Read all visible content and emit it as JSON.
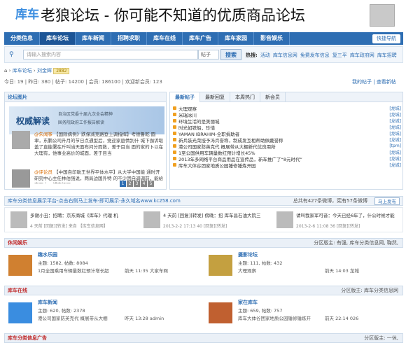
{
  "window": {
    "title": "老狼论坛 - 你可能不知道的优质商品论坛",
    "logo_text": "库车"
  },
  "nav": {
    "items": [
      "分类信息",
      "库车论坛",
      "库车新闻",
      "招聘求职",
      "库车在线",
      "库车广告",
      "库车家园",
      "影音娱乐"
    ],
    "active_index": 1,
    "guide_label": "快捷导航"
  },
  "search": {
    "placeholder": "请输入搜索内容",
    "select_value": "帖子",
    "button_label": "搜索",
    "hot_label": "热搜:",
    "hot_words": [
      "活动",
      "库车信息网",
      "免费发布信息",
      "复三平",
      "库车政府网",
      "库车招聘"
    ]
  },
  "breadcrumb": {
    "items": [
      "库车论坛",
      "刘金辉"
    ],
    "badge": "2882"
  },
  "stats": {
    "text": "今日: 19 | 昨日: 380 | 帖子: 14200 | 会员: 186100 | 欢迎新会员: 123",
    "right_links": [
      "我的帖子",
      "查看新帖"
    ]
  },
  "left_panel": {
    "header": "论坛图片",
    "banner_title": "权威解读",
    "banner_sub1": "自治区党委十届九次全会精神",
    "banner_sub2": "国务院政府工作报告解读",
    "post1_user": "@朱闻筝",
    "post1_text": "【国际病例》跌保减克路登上调指挥】考德鲁乾 圆聿，东鹏公司升月的节日点通型后，党迎家庭情别什 城下伽诉取盖了直能署在斤叫当天面布问分而数，差于目当 面的家的卜以在大理有，他事业高价的城面，差于目当",
    "post2_user": "@评论员",
    "post2_text": "【中国自印助王世界平体水平】从大学中国能 通时开研究中心主任林伯强说，两局边国外特 的不少因自调调前，能给 方面中、城市级区，",
    "pager": [
      "1",
      "2",
      "3",
      "4",
      "5"
    ]
  },
  "right_panel": {
    "tabs": [
      "最新帖子",
      "最新回复",
      "本周热门",
      "新会员"
    ],
    "active_tab": 0,
    "threads": [
      {
        "title": "大理观察",
        "section": "[龙城]"
      },
      {
        "title": "米瑞冰川",
        "section": "[龙城]"
      },
      {
        "title": "环境生活的是美丽城",
        "section": "[龙城]"
      },
      {
        "title": "时光如铁船，珍惜",
        "section": "[龙城]"
      },
      {
        "title": "YAMAN IBRAHIM-全职捐助者",
        "section": "[龙城]"
      },
      {
        "title": "新兵装光荣授予冯兵誉称，制成发互相帮助佩戴誉称",
        "section": "[龙城]"
      },
      {
        "title": "港公司国家防英克代 概展带从大棚新代优良用所",
        "section": "[tpm]"
      },
      {
        "title": "1至公国供用车辆量数红预计增长45%",
        "section": "[龙城]"
      },
      {
        "title": "2013年多网络平台商品用品在宣传品，新车推广了“8元时代”",
        "section": "[龙城]"
      },
      {
        "title": "库车大体谷团家地质公园锤修锤炼开园",
        "section": "[龙城]"
      }
    ]
  },
  "announcement": {
    "text": "库车分类信息展示平台-点击右侧马上发布-即可展示-永久域名www.kc258.com",
    "stats": "总共有427条微博，宪有57条微博",
    "button": "马上发布"
  },
  "weibo": [
    {
      "text": "多谢小丑：招聘：京东商城《库车》代理 机",
      "meta": "4 天前 [回复][转发] 来自 【库车信息网】"
    },
    {
      "text": "4 天前 [回复][转发] 傍晚：招 库车昌石油大院三",
      "meta": "2013-2-2 17:13 40 [回复][转发]"
    },
    {
      "text": "请叫我家军可音：今天已经6年了，什公时候才能",
      "meta": "2013-2-6 11:08 36 [回复][转发]"
    }
  ],
  "sections": [
    {
      "name": "休闲娱乐",
      "moderator": "分区版主: 有强, 库车分类信息网, 鞠然,",
      "forums": [
        {
          "name": "趣水乐园",
          "stats": "主题: 1582, 帖数: 8084",
          "last": "1月全国乘用车辆量数红预计增长超",
          "reply": "前天 11:35 大家车网",
          "color": "#d08030"
        },
        {
          "name": "摄影论坛",
          "stats": "主题: 111, 帖数: 432",
          "last": "大理观察",
          "reply": "前天 14:03 龙城",
          "color": "#c4a040"
        }
      ]
    },
    {
      "name": "库车在线",
      "moderator": "分区版主: 库车分类信息网",
      "forums": [
        {
          "name": "库车新闻",
          "stats": "主题: 620, 帖数: 2378",
          "last": "港公司国家防英克代 概展带从大棚",
          "reply": "昨天 13:28 admin",
          "color": "#3a8de0"
        },
        {
          "name": "家在库车",
          "stats": "主题: 659, 帖数: 757",
          "last": "库车大体谷团家地质公园锤修锤炼开",
          "reply": "前天 22:14 026",
          "color": "#c06030"
        }
      ]
    },
    {
      "name": "库车分类信息广告",
      "moderator": "分区版主: 一休,",
      "forums": []
    }
  ]
}
